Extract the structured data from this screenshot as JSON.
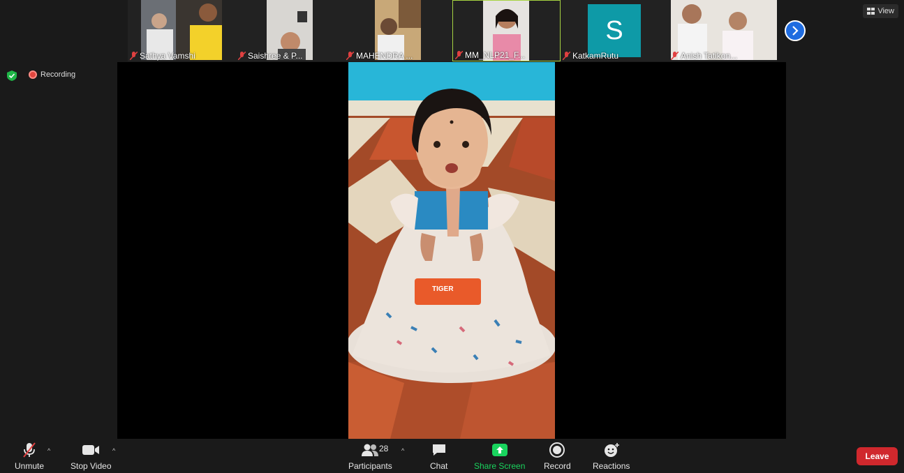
{
  "participants": [
    {
      "name": "Sathya Vamshi",
      "muted": true
    },
    {
      "name": "Saishree & P...",
      "muted": true
    },
    {
      "name": "MAHENDRA ...",
      "muted": true
    },
    {
      "name": "MM_NLP21_F...",
      "muted": true,
      "active": true
    },
    {
      "name": "KatkamRutu",
      "muted": true,
      "avatar_letter": "S"
    },
    {
      "name": "Anish Tatikon...",
      "muted": true
    }
  ],
  "view_label": "View",
  "recording_label": "Recording",
  "toolbar": {
    "unmute": "Unmute",
    "stop_video": "Stop Video",
    "participants": "Participants",
    "participants_count": "28",
    "chat": "Chat",
    "share_screen": "Share Screen",
    "record": "Record",
    "reactions": "Reactions",
    "leave": "Leave"
  },
  "colors": {
    "share_green": "#19d45e",
    "leave_red": "#d0282d",
    "active_border": "#a6d341",
    "avatar_teal": "#0e9aa7"
  }
}
